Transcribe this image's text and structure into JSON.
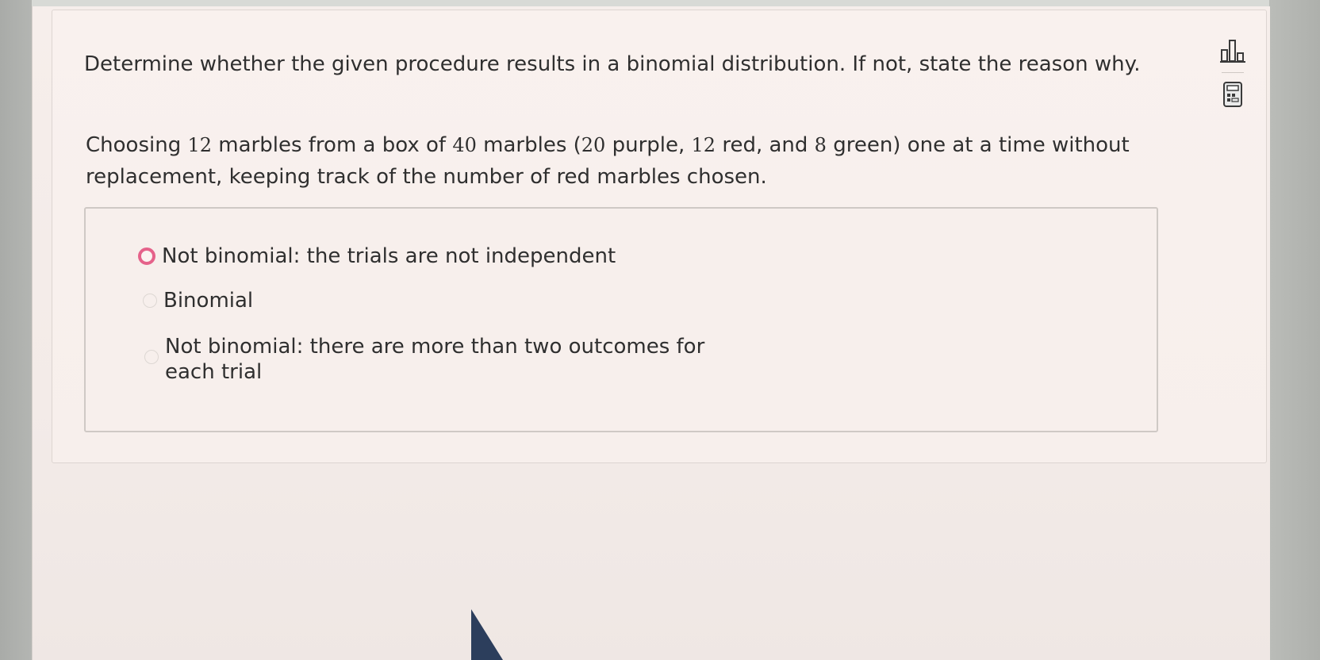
{
  "question": {
    "prompt": "Determine whether the given procedure results in a binomial distribution. If not, state the reason why.",
    "scenario": {
      "part1": "Choosing ",
      "marbles_chosen": "12",
      "part2": " marbles from a box of ",
      "total_marbles": "40",
      "part3": " marbles (",
      "purple_count": "20",
      "part4": " purple, ",
      "red_count": "12",
      "part5": " red, and ",
      "green_count": "8",
      "part6": " green) one at a time without replacement, keeping track of the number of red marbles chosen."
    }
  },
  "options": [
    {
      "label": "Not binomial: the trials are not independent",
      "selected": true
    },
    {
      "label": "Binomial",
      "selected": false
    },
    {
      "label": "Not binomial: there are more than two outcomes for each trial",
      "selected": false
    }
  ],
  "tools": [
    {
      "icon": "bar-chart-icon"
    },
    {
      "icon": "calculator-icon"
    }
  ],
  "colors": {
    "selected_radio": "#e5628a",
    "text": "#2f2f2f",
    "panel_background": "#f7efec"
  }
}
